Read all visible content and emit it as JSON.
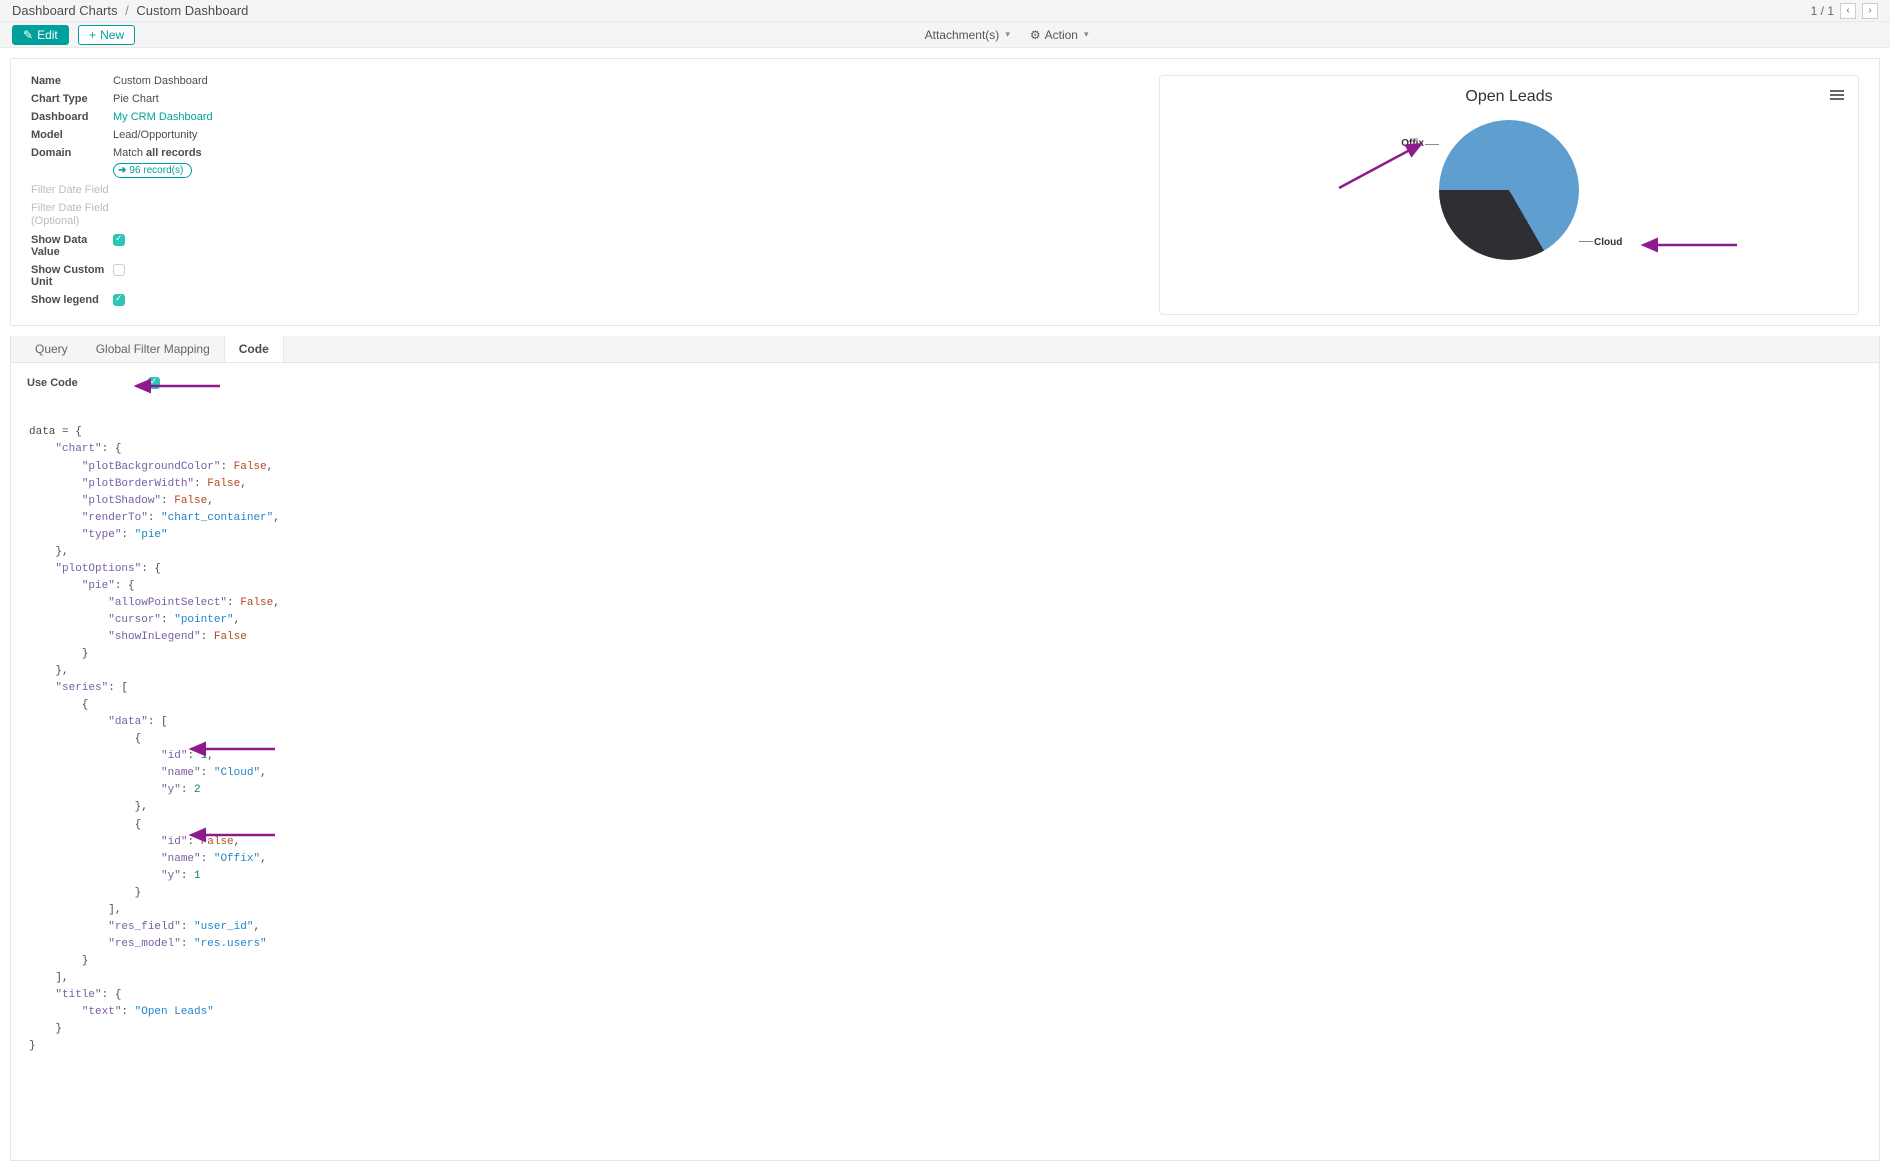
{
  "breadcrumbs": {
    "root": "Dashboard Charts",
    "current": "Custom Dashboard"
  },
  "pager": {
    "text": "1 / 1"
  },
  "actions": {
    "edit": "Edit",
    "new": "New",
    "attachments": "Attachment(s)",
    "action": "Action"
  },
  "fields": {
    "name_label": "Name",
    "name_value": "Custom Dashboard",
    "chart_type_label": "Chart Type",
    "chart_type_value": "Pie Chart",
    "dashboard_label": "Dashboard",
    "dashboard_value": "My CRM Dashboard",
    "model_label": "Model",
    "model_value": "Lead/Opportunity",
    "domain_label": "Domain",
    "domain_match": "Match ",
    "domain_all": "all records",
    "records_badge": "96 record(s)",
    "filter_date_label": "Filter Date Field",
    "filter_date_opt_label_1": "Filter Date Field",
    "filter_date_opt_label_2": "(Optional)",
    "show_data_value_label": "Show Data Value",
    "show_custom_unit_label": "Show Custom Unit",
    "show_legend_label": "Show legend"
  },
  "chart_labels": {
    "offix": "Offix",
    "cloud": "Cloud",
    "title": "Open Leads"
  },
  "tabs": {
    "query": "Query",
    "global_filter": "Global Filter Mapping",
    "code": "Code"
  },
  "code_tab": {
    "use_code_label": "Use Code"
  },
  "code_tokens": {
    "t01": "data",
    "t02": "\"chart\"",
    "t03": "\"plotBackgroundColor\"",
    "t04": "False",
    "t05": "\"plotBorderWidth\"",
    "t06": "\"plotShadow\"",
    "t07": "\"renderTo\"",
    "t08": "\"chart_container\"",
    "t09": "\"type\"",
    "t10": "\"pie\"",
    "t11": "\"plotOptions\"",
    "t12": "\"pie\"",
    "t13": "\"allowPointSelect\"",
    "t14": "\"cursor\"",
    "t15": "\"pointer\"",
    "t16": "\"showInLegend\"",
    "t17": "\"series\"",
    "t18": "\"data\"",
    "t19": "\"id\"",
    "t20": "1",
    "t21": "\"name\"",
    "t22": "\"Cloud\"",
    "t23": "\"y\"",
    "t24": "2",
    "t25": "\"id\"",
    "t26": "\"name\"",
    "t27": "\"Offix\"",
    "t28": "\"y\"",
    "t29": "1",
    "t30": "\"res_field\"",
    "t31": "\"user_id\"",
    "t32": "\"res_model\"",
    "t33": "\"res.users\"",
    "t34": "\"title\"",
    "t35": "\"text\"",
    "t36": "\"Open Leads\""
  },
  "chart_data": {
    "type": "pie",
    "title": "Open Leads",
    "series": [
      {
        "name": "Cloud",
        "y": 2,
        "id": 1
      },
      {
        "name": "Offix",
        "y": 1,
        "id": false
      }
    ]
  }
}
